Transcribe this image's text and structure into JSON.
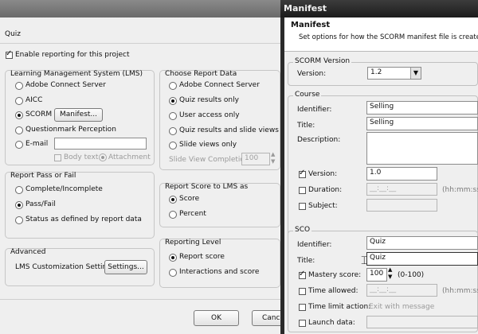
{
  "quiz_dialog": {
    "breadcrumb": "Quiz",
    "enable_reporting": "Enable reporting for this project",
    "lms": {
      "title": "Learning Management System (LMS)",
      "options": [
        "Adobe Connect Server",
        "AICC",
        "SCORM",
        "Questionmark Perception",
        "E-mail"
      ],
      "selected": "SCORM",
      "manifest_button": "Manifest...",
      "email_body_text": "Body text",
      "email_attachment": "Attachment"
    },
    "report_data": {
      "title": "Choose Report Data",
      "options": [
        "Adobe Connect Server",
        "Quiz results only",
        "User access only",
        "Quiz results and slide views",
        "Slide views only"
      ],
      "selected": "Quiz results only",
      "slide_view_completion_label": "Slide View Completion:",
      "slide_view_completion_value": "100"
    },
    "pass_fail": {
      "title": "Report Pass or Fail",
      "options": [
        "Complete/Incomplete",
        "Pass/Fail",
        "Status as defined by report data"
      ],
      "selected": "Pass/Fail"
    },
    "score_to_lms": {
      "title": "Report Score to LMS as",
      "options": [
        "Score",
        "Percent"
      ],
      "selected": "Score"
    },
    "advanced": {
      "title": "Advanced",
      "label": "LMS Customization Settings",
      "settings_button": "Settings..."
    },
    "reporting_level": {
      "title": "Reporting Level",
      "options": [
        "Report score",
        "Interactions and score"
      ],
      "selected": "Report score"
    },
    "ok_button": "OK",
    "cancel_button": "Canc"
  },
  "manifest_dialog": {
    "window_title": "Manifest",
    "header_title": "Manifest",
    "header_subtitle": "Set options for how the SCORM manifest file is created.",
    "scorm_version": {
      "group_title": "SCORM Version",
      "label": "Version:",
      "value": "1.2"
    },
    "course": {
      "group_title": "Course",
      "identifier_label": "Identifier:",
      "identifier_value": "Selling",
      "title_label": "Title:",
      "title_value": "Selling",
      "description_label": "Description:",
      "description_value": "",
      "version_label": "Version:",
      "version_value": "1.0",
      "version_checked": true,
      "duration_label": "Duration:",
      "duration_placeholder": "__:__:__",
      "duration_hint": "(hh:mm:ss)",
      "subject_label": "Subject:"
    },
    "sco": {
      "group_title": "SCO",
      "identifier_label": "Identifier:",
      "identifier_value": "Quiz",
      "title_label": "Title:",
      "title_value": "Quiz",
      "mastery_label": "Mastery score:",
      "mastery_value": "100",
      "mastery_range": "(0-100)",
      "mastery_checked": true,
      "time_allowed_label": "Time allowed:",
      "time_allowed_placeholder": "__:__:__",
      "time_allowed_hint": "(hh:mm:ss)",
      "time_limit_label": "Time limit action:",
      "time_limit_value": "Exit with message",
      "launch_data_label": "Launch data:"
    }
  },
  "colors": {
    "dialog_bg": "#efefef",
    "manifest_titlebar": "#2a2a2a"
  }
}
